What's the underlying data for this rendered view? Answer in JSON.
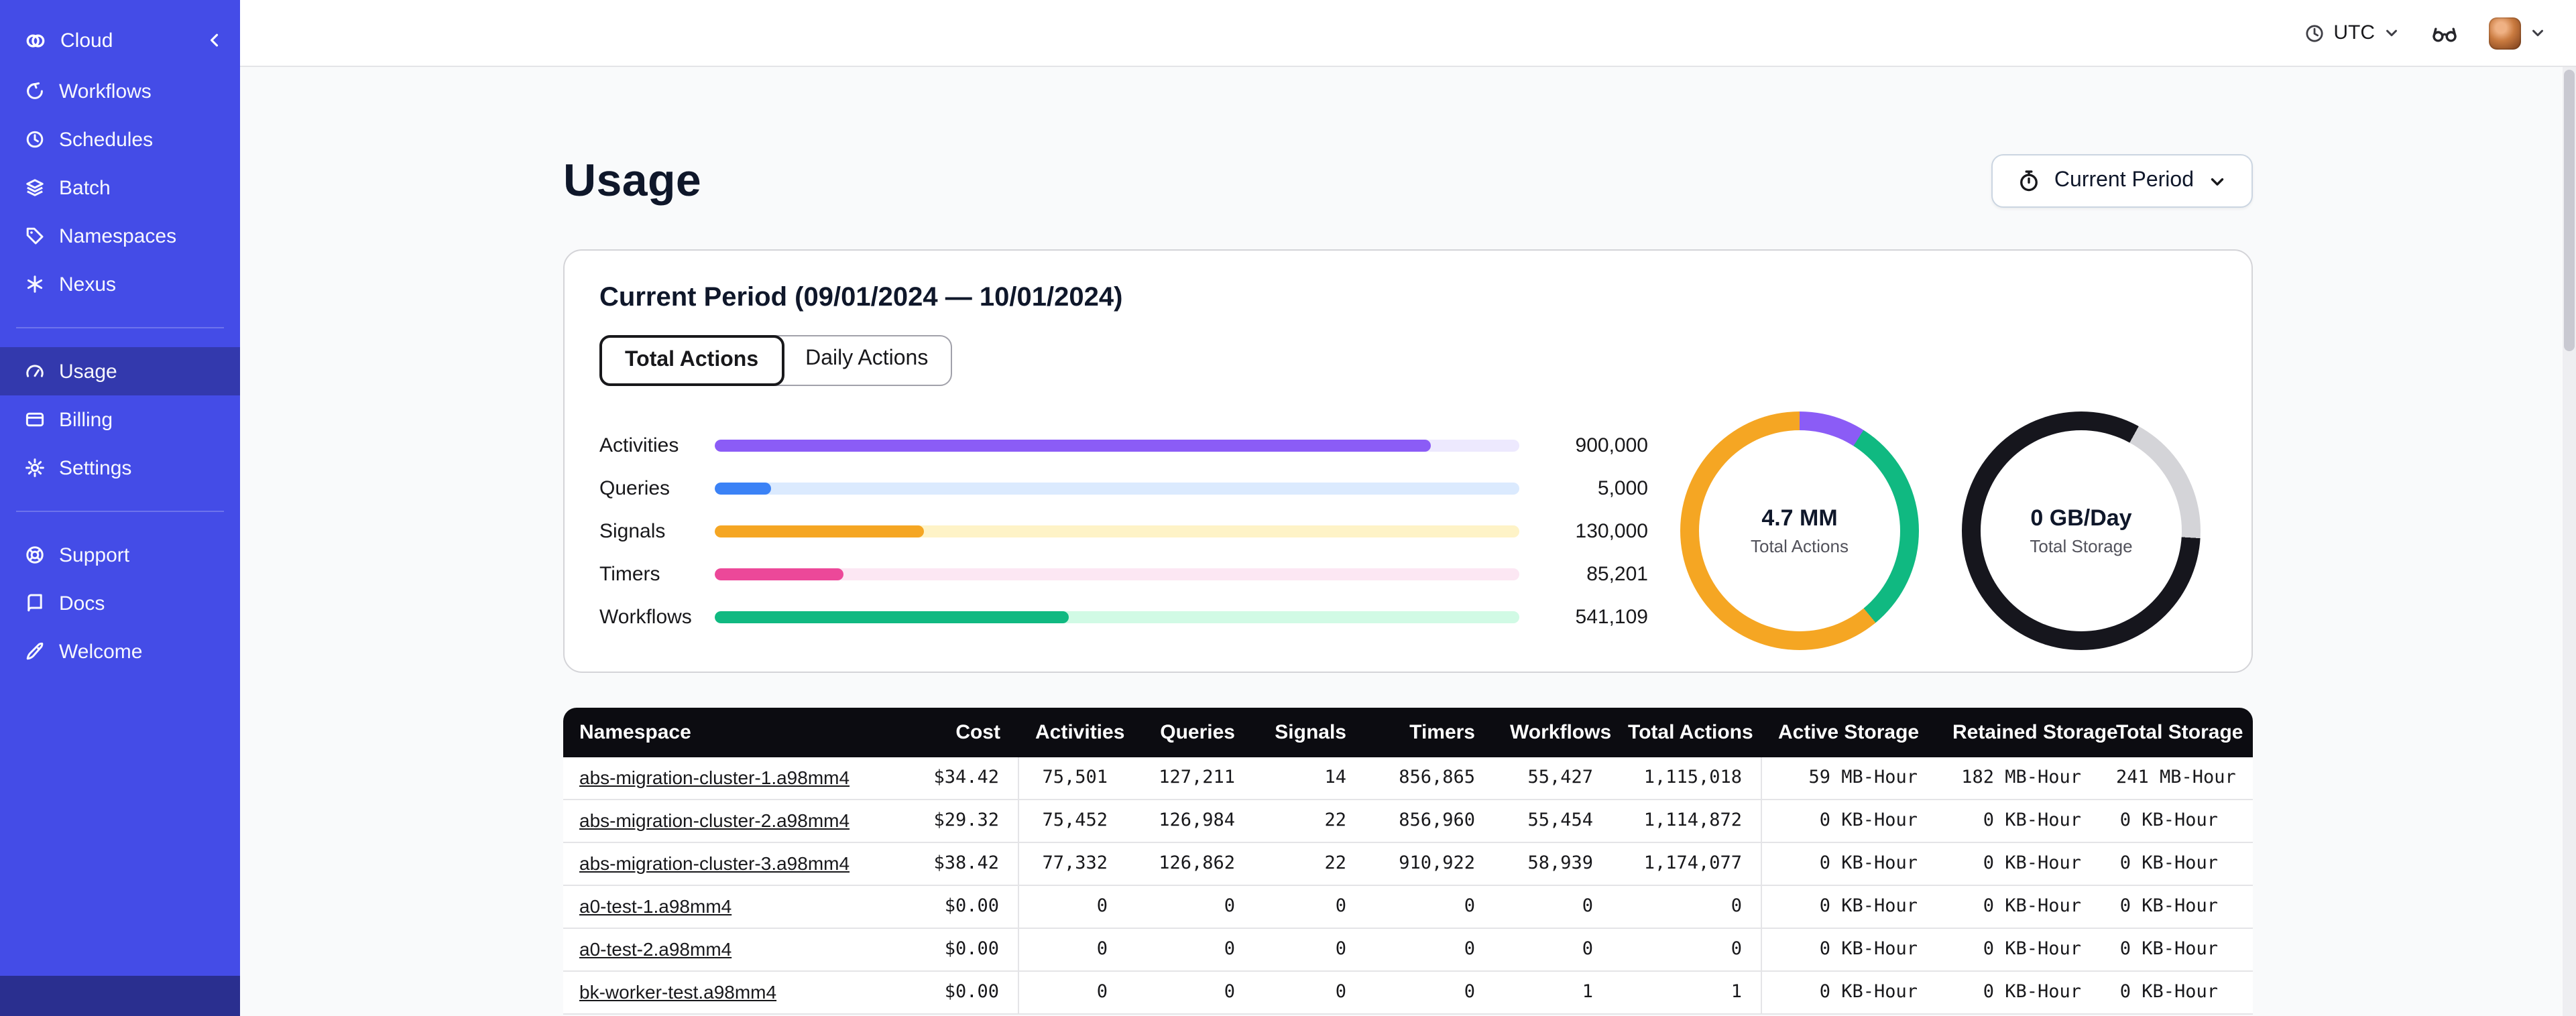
{
  "topbar": {
    "timezone_label": "UTC"
  },
  "sidebar": {
    "brand_label": "Cloud",
    "brand_icon": "temporal-logo-icon",
    "items": [
      {
        "label": "Workflows",
        "icon": "workflows-icon"
      },
      {
        "label": "Schedules",
        "icon": "schedules-icon"
      },
      {
        "label": "Batch",
        "icon": "batch-icon"
      },
      {
        "label": "Namespaces",
        "icon": "namespaces-icon"
      },
      {
        "label": "Nexus",
        "icon": "nexus-icon"
      },
      {
        "label": "Usage",
        "icon": "usage-icon",
        "active": true
      },
      {
        "label": "Billing",
        "icon": "billing-icon"
      },
      {
        "label": "Settings",
        "icon": "settings-icon"
      },
      {
        "label": "Support",
        "icon": "support-icon"
      },
      {
        "label": "Docs",
        "icon": "docs-icon"
      },
      {
        "label": "Welcome",
        "icon": "welcome-icon"
      }
    ]
  },
  "page": {
    "title": "Usage",
    "period_button_label": "Current Period"
  },
  "card": {
    "title": "Current Period (09/01/2024 — 10/01/2024)",
    "tabs": [
      {
        "label": "Total Actions",
        "active": true
      },
      {
        "label": "Daily Actions",
        "active": false
      }
    ]
  },
  "chart_data": [
    {
      "type": "bar",
      "name": "actions-by-type",
      "orientation": "horizontal",
      "categories": [
        "Activities",
        "Queries",
        "Signals",
        "Timers",
        "Workflows"
      ],
      "values": [
        900000,
        5000,
        130000,
        85201,
        541109
      ],
      "value_labels": [
        "900,000",
        "5,000",
        "130,000",
        "85,201",
        "541,109"
      ],
      "fill_pcts": [
        89,
        7,
        26,
        16,
        44
      ],
      "colors": [
        "#8B5CF6",
        "#3B82F6",
        "#F5A623",
        "#EC4899",
        "#10B981"
      ],
      "track_colors": [
        "#EDE9FE",
        "#DBEAFE",
        "#FEF3C7",
        "#FCE7F3",
        "#D1FAE5"
      ],
      "legend": "none",
      "grid": false
    },
    {
      "type": "pie",
      "name": "total-actions-donut",
      "center_value": "4.7 MM",
      "center_label": "Total Actions",
      "segments": [
        {
          "label": "activities",
          "pct": 9,
          "color": "#8B5CF6"
        },
        {
          "label": "workflows",
          "pct": 30,
          "color": "#10B981"
        },
        {
          "label": "other",
          "pct": 61,
          "color": "#F5A623"
        }
      ]
    },
    {
      "type": "pie",
      "name": "total-storage-donut",
      "center_value": "0 GB/Day",
      "center_label": "Total Storage",
      "segments": [
        {
          "label": "dark",
          "pct": 8,
          "color": "#16161D"
        },
        {
          "label": "gray",
          "pct": 18,
          "color": "#D4D4D8"
        },
        {
          "label": "dark2",
          "pct": 74,
          "color": "#16161D"
        }
      ]
    }
  ],
  "table": {
    "columns": [
      {
        "label": "Namespace",
        "align": "left"
      },
      {
        "label": "Cost",
        "align": "right",
        "divider_after": true
      },
      {
        "label": "Activities",
        "align": "right"
      },
      {
        "label": "Queries",
        "align": "right"
      },
      {
        "label": "Signals",
        "align": "right"
      },
      {
        "label": "Timers",
        "align": "right"
      },
      {
        "label": "Workflows",
        "align": "right"
      },
      {
        "label": "Total Actions",
        "align": "right",
        "divider_after": true
      },
      {
        "label": "Active Storage",
        "align": "right"
      },
      {
        "label": "Retained Storage",
        "align": "right"
      },
      {
        "label": "Total Storage",
        "align": "right"
      }
    ],
    "rows": [
      {
        "namespace": "abs-migration-cluster-1.a98mm4",
        "cells": [
          "$34.42",
          "75,501",
          "127,211",
          "14",
          "856,865",
          "55,427",
          "1,115,018",
          "59 MB-Hour",
          "182 MB-Hour",
          "241 MB-Hour"
        ]
      },
      {
        "namespace": "abs-migration-cluster-2.a98mm4",
        "cells": [
          "$29.32",
          "75,452",
          "126,984",
          "22",
          "856,960",
          "55,454",
          "1,114,872",
          "0 KB-Hour",
          "0 KB-Hour",
          "0 KB-Hour"
        ]
      },
      {
        "namespace": "abs-migration-cluster-3.a98mm4",
        "cells": [
          "$38.42",
          "77,332",
          "126,862",
          "22",
          "910,922",
          "58,939",
          "1,174,077",
          "0 KB-Hour",
          "0 KB-Hour",
          "0 KB-Hour"
        ]
      },
      {
        "namespace": "a0-test-1.a98mm4",
        "cells": [
          "$0.00",
          "0",
          "0",
          "0",
          "0",
          "0",
          "0",
          "0 KB-Hour",
          "0 KB-Hour",
          "0 KB-Hour"
        ]
      },
      {
        "namespace": "a0-test-2.a98mm4",
        "cells": [
          "$0.00",
          "0",
          "0",
          "0",
          "0",
          "0",
          "0",
          "0 KB-Hour",
          "0 KB-Hour",
          "0 KB-Hour"
        ]
      },
      {
        "namespace": "bk-worker-test.a98mm4",
        "cells": [
          "$0.00",
          "0",
          "0",
          "0",
          "0",
          "1",
          "1",
          "0 KB-Hour",
          "0 KB-Hour",
          "0 KB-Hour"
        ]
      }
    ]
  },
  "colors": {
    "sidebar_bg": "#444CE7",
    "sidebar_active_bg": "#343BB6",
    "table_header_bg": "#0C0C11",
    "page_bg": "#F9FAFB"
  }
}
